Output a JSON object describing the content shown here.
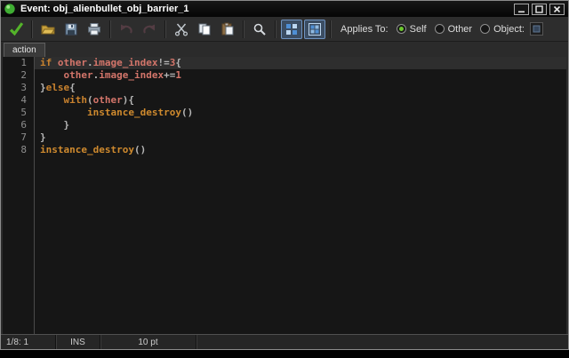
{
  "window": {
    "title": "Event: obj_alienbullet_obj_barrier_1"
  },
  "toolbar": {
    "buttons": [
      {
        "name": "ok-button",
        "icon": "check-icon",
        "group": 0
      },
      {
        "name": "load-button",
        "icon": "open-folder-icon",
        "group": 1
      },
      {
        "name": "save-button",
        "icon": "floppy-icon",
        "group": 1
      },
      {
        "name": "print-button",
        "icon": "printer-icon",
        "group": 1
      },
      {
        "name": "undo-button",
        "icon": "undo-icon",
        "group": 2,
        "disabled": true
      },
      {
        "name": "redo-button",
        "icon": "redo-icon",
        "group": 2,
        "disabled": true
      },
      {
        "name": "cut-button",
        "icon": "scissors-icon",
        "group": 3
      },
      {
        "name": "copy-button",
        "icon": "copy-icon",
        "group": 3
      },
      {
        "name": "paste-button",
        "icon": "paste-icon",
        "group": 3
      },
      {
        "name": "find-button",
        "icon": "magnifier-icon",
        "group": 4
      },
      {
        "name": "line-numbers-toggle",
        "icon": "grid-icon",
        "group": 5,
        "pressed": true
      },
      {
        "name": "syntax-colors-toggle",
        "icon": "grid2-icon",
        "group": 5,
        "pressed": true
      }
    ],
    "applies_to": {
      "label": "Applies To:",
      "options": [
        {
          "label": "Self",
          "selected": true
        },
        {
          "label": "Other",
          "selected": false
        },
        {
          "label": "Object:",
          "selected": false
        }
      ]
    }
  },
  "tabs": [
    {
      "label": "action",
      "active": true
    }
  ],
  "editor": {
    "lines": [
      {
        "no": "1",
        "current": true,
        "segments": [
          {
            "t": "if",
            "c": "kw"
          },
          {
            "t": " ",
            "c": "d"
          },
          {
            "t": "other",
            "c": "bi"
          },
          {
            "t": ".",
            "c": "d"
          },
          {
            "t": "image_index",
            "c": "bi"
          },
          {
            "t": "!=",
            "c": "d"
          },
          {
            "t": "3",
            "c": "num"
          },
          {
            "t": "{",
            "c": "d"
          }
        ]
      },
      {
        "no": "2",
        "current": false,
        "segments": [
          {
            "t": "    ",
            "c": "d"
          },
          {
            "t": "other",
            "c": "bi"
          },
          {
            "t": ".",
            "c": "d"
          },
          {
            "t": "image_index",
            "c": "bi"
          },
          {
            "t": "+=",
            "c": "d"
          },
          {
            "t": "1",
            "c": "num"
          }
        ]
      },
      {
        "no": "3",
        "current": false,
        "segments": [
          {
            "t": "}",
            "c": "d"
          },
          {
            "t": "else",
            "c": "kw"
          },
          {
            "t": "{",
            "c": "d"
          }
        ]
      },
      {
        "no": "4",
        "current": false,
        "segments": [
          {
            "t": "    ",
            "c": "d"
          },
          {
            "t": "with",
            "c": "kw"
          },
          {
            "t": "(",
            "c": "d"
          },
          {
            "t": "other",
            "c": "bi"
          },
          {
            "t": "){",
            "c": "d"
          }
        ]
      },
      {
        "no": "5",
        "current": false,
        "segments": [
          {
            "t": "        ",
            "c": "d"
          },
          {
            "t": "instance_destroy",
            "c": "fn"
          },
          {
            "t": "()",
            "c": "d"
          }
        ]
      },
      {
        "no": "6",
        "current": false,
        "segments": [
          {
            "t": "    }",
            "c": "d"
          }
        ]
      },
      {
        "no": "7",
        "current": false,
        "segments": [
          {
            "t": "}",
            "c": "d"
          }
        ]
      },
      {
        "no": "8",
        "current": false,
        "segments": [
          {
            "t": "instance_destroy",
            "c": "fn"
          },
          {
            "t": "()",
            "c": "d"
          }
        ]
      }
    ]
  },
  "statusbar": {
    "cells": [
      "1/8:  1",
      "INS",
      "10 pt"
    ]
  },
  "colors": {
    "accent_green": "#6cc92e",
    "toggle_blue": "#4f8fd4",
    "keyword": "#c9822e",
    "builtin": "#d3756a",
    "function": "#cf8a2e",
    "editor_bg": "#161616",
    "current_line_bg": "#2e2e2e"
  }
}
